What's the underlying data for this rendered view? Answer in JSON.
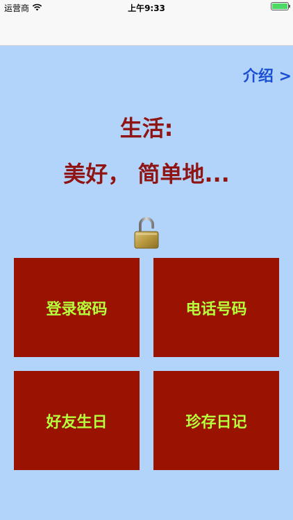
{
  "status_bar": {
    "carrier": "运营商",
    "time": "上午9:33",
    "battery_percent": 100
  },
  "intro_link": "介绍 >",
  "headline": {
    "line1": "生活:",
    "line2": "美好， 简单地..."
  },
  "icons": {
    "wifi": "wifi-icon",
    "battery": "battery-icon",
    "lock": "unlocked-padlock-icon"
  },
  "tiles": [
    {
      "label": "登录密码"
    },
    {
      "label": "电话号码"
    },
    {
      "label": "好友生日"
    },
    {
      "label": "珍存日记"
    }
  ],
  "colors": {
    "background": "#b3d4fa",
    "tile": "#9a1200",
    "tile_text": "#b5ff3b",
    "headline": "#8f1414",
    "link": "#1a4fd1"
  }
}
